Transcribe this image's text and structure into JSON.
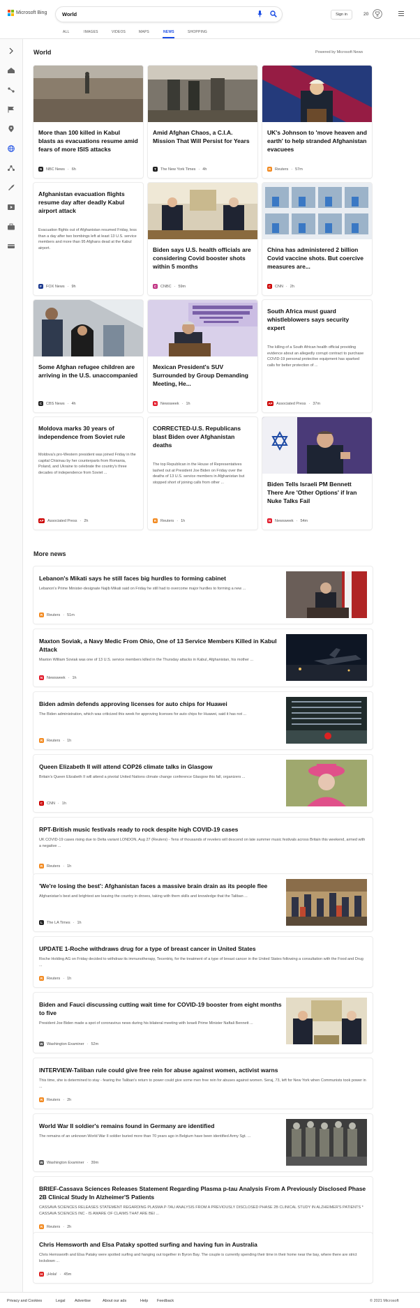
{
  "brand": {
    "name": "Microsoft Bing",
    "colors": [
      "#f25022",
      "#7fba00",
      "#00a4ef",
      "#ffb900"
    ]
  },
  "search": {
    "value": "World"
  },
  "header": {
    "signin": "Sign in",
    "rewards_count": "20"
  },
  "tabs": [
    "ALL",
    "IMAGES",
    "VIDEOS",
    "MAPS",
    "NEWS",
    "SHOPPING"
  ],
  "active_tab": "NEWS",
  "sidebar": {
    "icons": [
      "expand-arrow-icon",
      "home-icon",
      "science-icon",
      "flag-icon",
      "location-pin-icon",
      "globe-icon",
      "nodes-icon",
      "rocket-icon",
      "entertainment-icon",
      "business-icon",
      "money-icon"
    ]
  },
  "section": {
    "title": "World",
    "powered": "Powered by Microsoft News"
  },
  "cards": [
    {
      "title": "More than 100 killed in Kabul blasts as evacuations resume amid fears of more ISIS attacks",
      "snippet": "",
      "source": "NBC News",
      "time": "6h",
      "logo": "N",
      "logo_color": "#222"
    },
    {
      "title": "Amid Afghan Chaos, a C.I.A. Mission That Will Persist for Years",
      "snippet": "",
      "source": "The New York Times",
      "time": "4h",
      "logo": "T",
      "logo_color": "#222"
    },
    {
      "title": "UK's Johnson to 'move heaven and earth' to help stranded Afghanistan evacuees",
      "snippet": "",
      "source": "Reuters",
      "time": "57m",
      "logo": "R",
      "logo_color": "#f28a21"
    },
    {
      "title": "Afghanistan evacuation flights resume day after deadly Kabul airport attack",
      "snippet": "Evacuation flights out of Afghanistan resumed Friday, less than a day after two bombings left at least 13 U.S. service members and more than 95 Afghans dead at the Kabul airport.",
      "source": "FOX News",
      "time": "9h",
      "logo": "F",
      "logo_color": "#1d3a8f"
    },
    {
      "title": "Biden says U.S. health officials are considering Covid booster shots within 5 months",
      "snippet": "",
      "source": "CNBC",
      "time": "59m",
      "logo": "C",
      "logo_color": "#c13584"
    },
    {
      "title": "China has administered 2 billion Covid vaccine shots. But coercive measures are...",
      "snippet": "",
      "source": "CNN",
      "time": "2h",
      "logo": "C",
      "logo_color": "#cc0000"
    },
    {
      "title": "Some Afghan refugee children are arriving in the U.S. unaccompanied",
      "snippet": "",
      "source": "CBS News",
      "time": "4h",
      "logo": "C",
      "logo_color": "#222"
    },
    {
      "title": "Mexican President's SUV Surrounded by Group Demanding Meeting, He...",
      "snippet": "",
      "source": "Newsweek",
      "time": "1h",
      "logo": "N",
      "logo_color": "#e21b2b"
    },
    {
      "title": "South Africa must guard whistleblowers says security expert",
      "snippet": "The killing of a South African health official providing evidence about an allegedly corrupt contract to purchase COVID-19 personal protective equipment has sparked calls for better protection of ...",
      "source": "Associated Press",
      "time": "37m",
      "logo": "AP",
      "logo_color": "#cc0000"
    },
    {
      "title": "Moldova marks 30 years of independence from Soviet rule",
      "snippet": "Moldova's pro-Western president was joined Friday in the capital Chisinau by her counterparts from Romania, Poland, and Ukraine to celebrate the country's three decades of independence from Soviet ...",
      "source": "Associated Press",
      "time": "2h",
      "logo": "AP",
      "logo_color": "#cc0000"
    },
    {
      "title": "CORRECTED-U.S. Republicans blast Biden over Afghanistan deaths",
      "snippet": "The top Republican in the House of Representatives lashed out at President Joe Biden on Friday over the deaths of 13 U.S. service members in Afghanistan but stopped short of joining calls from other ...",
      "source": "Reuters",
      "time": "1h",
      "logo": "R",
      "logo_color": "#f28a21"
    },
    {
      "title": "Biden Tells Israeli PM Bennett There Are 'Other Options' if Iran Nuke Talks Fail",
      "snippet": "",
      "source": "Newsweek",
      "time": "54m",
      "logo": "N",
      "logo_color": "#e21b2b"
    }
  ],
  "more": {
    "title": "More news"
  },
  "news": [
    {
      "title": "Lebanon's Mikati says he still faces big hurdles to forming cabinet",
      "snippet": "Lebanon's Prime Minister-designate Najib Mikati said on Friday he still had to overcome major hurdles to forming a new ...",
      "source": "Reuters",
      "time": "51m",
      "logo": "R",
      "logo_color": "#f28a21"
    },
    {
      "title": "Maxton Soviak, a Navy Medic From Ohio, One of 13 Service Members Killed in Kabul Attack",
      "snippet": "Maxton William Soviak was one of 13 U.S. service members killed in the Thursday attacks in Kabul, Afghanistan, his mother ...",
      "source": "Newsweek",
      "time": "1h",
      "logo": "N",
      "logo_color": "#e21b2b"
    },
    {
      "title": "Biden admin defends approving licenses for auto chips for Huawei",
      "snippet": "The Biden administration, which was criticized this week for approving licenses for auto chips for Huawei, said it has not ...",
      "source": "Reuters",
      "time": "1h",
      "logo": "R",
      "logo_color": "#f28a21"
    },
    {
      "title": "Queen Elizabeth II will attend COP26 climate talks in Glasgow",
      "snippet": "Britain's Queen Elizabeth II will attend a pivotal United Nations climate change conference Glasgow this fall, organizers ...",
      "source": "CNN",
      "time": "1h",
      "logo": "C",
      "logo_color": "#cc0000"
    },
    {
      "title": "RPT-British music festivals ready to rock despite high COVID-19 cases",
      "snippet": "UK COVID-19 cases rising due to Delta variant LONDON, Aug 27 (Reuters) - Tens of thousands of revelers will descend on late summer music festivals across Britain this weekend, armed with a negative ...",
      "source": "Reuters",
      "time": "1h",
      "logo": "R",
      "logo_color": "#f28a21"
    },
    {
      "title": "'We're losing the best': Afghanistan faces a massive brain drain as its people flee",
      "snippet": "Afghanistan's best and brightest are leaving the country in droves, taking with them skills and knowledge that the Taliban ...",
      "source": "The LA Times",
      "time": "1h",
      "logo": "L",
      "logo_color": "#222"
    },
    {
      "title": "UPDATE 1-Roche withdraws drug for a type of breast cancer in United States",
      "snippet": "Roche Holding AG on Friday decided to withdraw its immunotherapy, Tecentriq, for the treatment of a type of breast cancer in the United States following a consultation with the Food and Drug ...",
      "source": "Reuters",
      "time": "1h",
      "logo": "R",
      "logo_color": "#f28a21"
    },
    {
      "title": "Biden and Fauci discussing cutting wait time for COVID-19 booster from eight months to five",
      "snippet": "President Joe Biden made a spot of coronavirus news during his bilateral meeting with Israeli Prime Minister Naftali Bennett ...",
      "source": "Washington Examiner",
      "time": "52m",
      "logo": "W",
      "logo_color": "#555"
    },
    {
      "title": "INTERVIEW-Taliban rule could give free rein for abuse against women, activist warns",
      "snippet": "This time, she is determined to stay - fearing the Taliban's return to power could give some men free rein for abuses against women. Seraj, 73, left for New York when Communists took power in ...",
      "source": "Reuters",
      "time": "2h",
      "logo": "R",
      "logo_color": "#f28a21"
    },
    {
      "title": "World War II soldier's remains found in Germany are identified",
      "snippet": "The remains of an unknown World War II soldier buried more than 70 years ago in Belgium have been identified Army Sgt. ...",
      "source": "Washington Examiner",
      "time": "39m",
      "logo": "W",
      "logo_color": "#555"
    },
    {
      "title": "BRIEF-Cassava Sciences Releases Statement Regarding Plasma p-tau Analysis From A Previously Disclosed Phase 2B Clinical Study In Alzheimer'S Patients",
      "snippet": "CASSAVA SCIENCES RELEASES STATEMENT REGARDING PLASMA P-TAU ANALYSIS FROM A PREVIOUSLY DISCLOSED PHASE 2B CLINICAL STUDY IN ALZHEIMER'S PATIENTS * CASSAVA SCIENCES INC - IS AWARE OF CLAIMS THAT ARE BEI ...",
      "source": "Reuters",
      "time": "2h",
      "logo": "R",
      "logo_color": "#f28a21"
    },
    {
      "title": "Chris Hemsworth and Elsa Pataky spotted surfing and having fun in Australia",
      "snippet": "Chris Hemsworth and Elsa Pataky were spotted surfing and hanging out together in Byron Bay. The couple is currently spending their time in their home near the bay, where there are strict lockdown ...",
      "source": "¡Hola!",
      "time": "45m",
      "logo": "H",
      "logo_color": "#d22"
    }
  ],
  "footer": {
    "links": [
      "Privacy and Cookies",
      "Legal",
      "Advertise",
      "About our ads",
      "Help",
      "Feedback"
    ],
    "copyright": "© 2021 Microsoft"
  }
}
